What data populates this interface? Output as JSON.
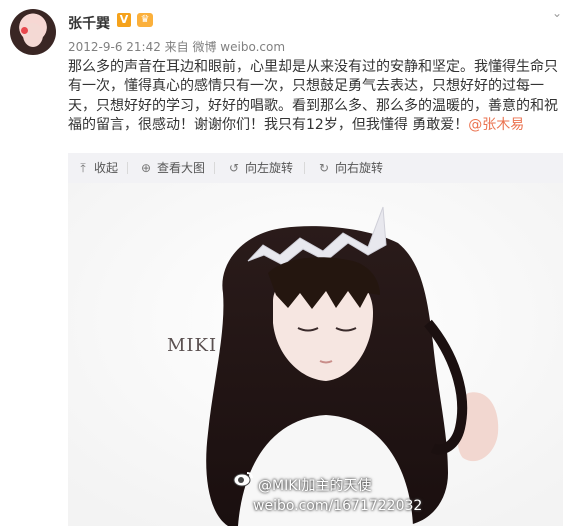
{
  "post": {
    "author": "张千巽",
    "badges": {
      "verified": "V",
      "crown": "♛"
    },
    "meta": "2012-9-6 21:42 来自 微博 weibo.com",
    "text": "那么多的声音在耳边和眼前，心里却是从来没有过的安静和坚定。我懂得生命只有一次，懂得真心的感情只有一次，只想鼓足勇气去表达，只想好好的过每一天，只想好好的学习，好好的唱歌。看到那么多、那么多的温暖的，善意的和祝福的留言，很感动！谢谢你们！我只有12岁，但我懂得 勇敢爱！",
    "mention": "@张木易"
  },
  "toolbar": {
    "collapse": "收起",
    "view_large": "查看大图",
    "rotate_left": "向左旋转",
    "rotate_right": "向右旋转"
  },
  "image": {
    "title_text": "MIKI",
    "watermark_line1": "@MIKI加主的天使",
    "watermark_line2": "weibo.com/1671722032"
  },
  "colors": {
    "link": "#eb7350",
    "toolbar_bg": "#f2f2f5",
    "meta_text": "#808080",
    "verified_badge": "#f5a21b"
  },
  "icons": [
    "avatar",
    "verified-badge-icon",
    "crown-icon",
    "chevron-down-icon",
    "collapse-icon",
    "zoom-icon",
    "rotate-left-icon",
    "rotate-right-icon",
    "weibo-logo-icon"
  ]
}
